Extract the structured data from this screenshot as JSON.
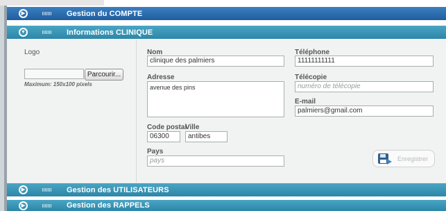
{
  "sections": {
    "compte": "Gestion du COMPTE",
    "clinique": "Informations CLINIQUE",
    "utilisateurs": "Gestion des UTILISATEURS",
    "rappels": "Gestion des RAPPELS"
  },
  "logo": {
    "label": "Logo",
    "browse": "Parcourir...",
    "note": "Maximum: 150x100 pixels"
  },
  "form": {
    "nom_label": "Nom",
    "nom_value": "clinique des palmiers",
    "adresse_label": "Adresse",
    "adresse_value": "avenue des pins",
    "cp_label": "Code postal",
    "cp_value": "06300",
    "ville_label": "Ville",
    "ville_value": "antibes",
    "pays_label": "Pays",
    "pays_placeholder": "pays",
    "tel_label": "Téléphone",
    "tel_value": "11111111111",
    "fax_label": "Télécopie",
    "fax_placeholder": "numéro de télécopie",
    "email_label": "E-mail",
    "email_value": "palmiers@gmail.com"
  },
  "save_label": "Enregistrer",
  "icons": {
    "section_toggle_collapsed": "play-circle-icon",
    "section_toggle_expanded": "chevron-down-circle-icon",
    "section_grip": "grip-icon",
    "save": "floppy-disk-icon"
  },
  "colors": {
    "header_dark": "#1f5e9f",
    "header_teal": "#2c86a8",
    "panel_bg": "#f1f2f2"
  }
}
